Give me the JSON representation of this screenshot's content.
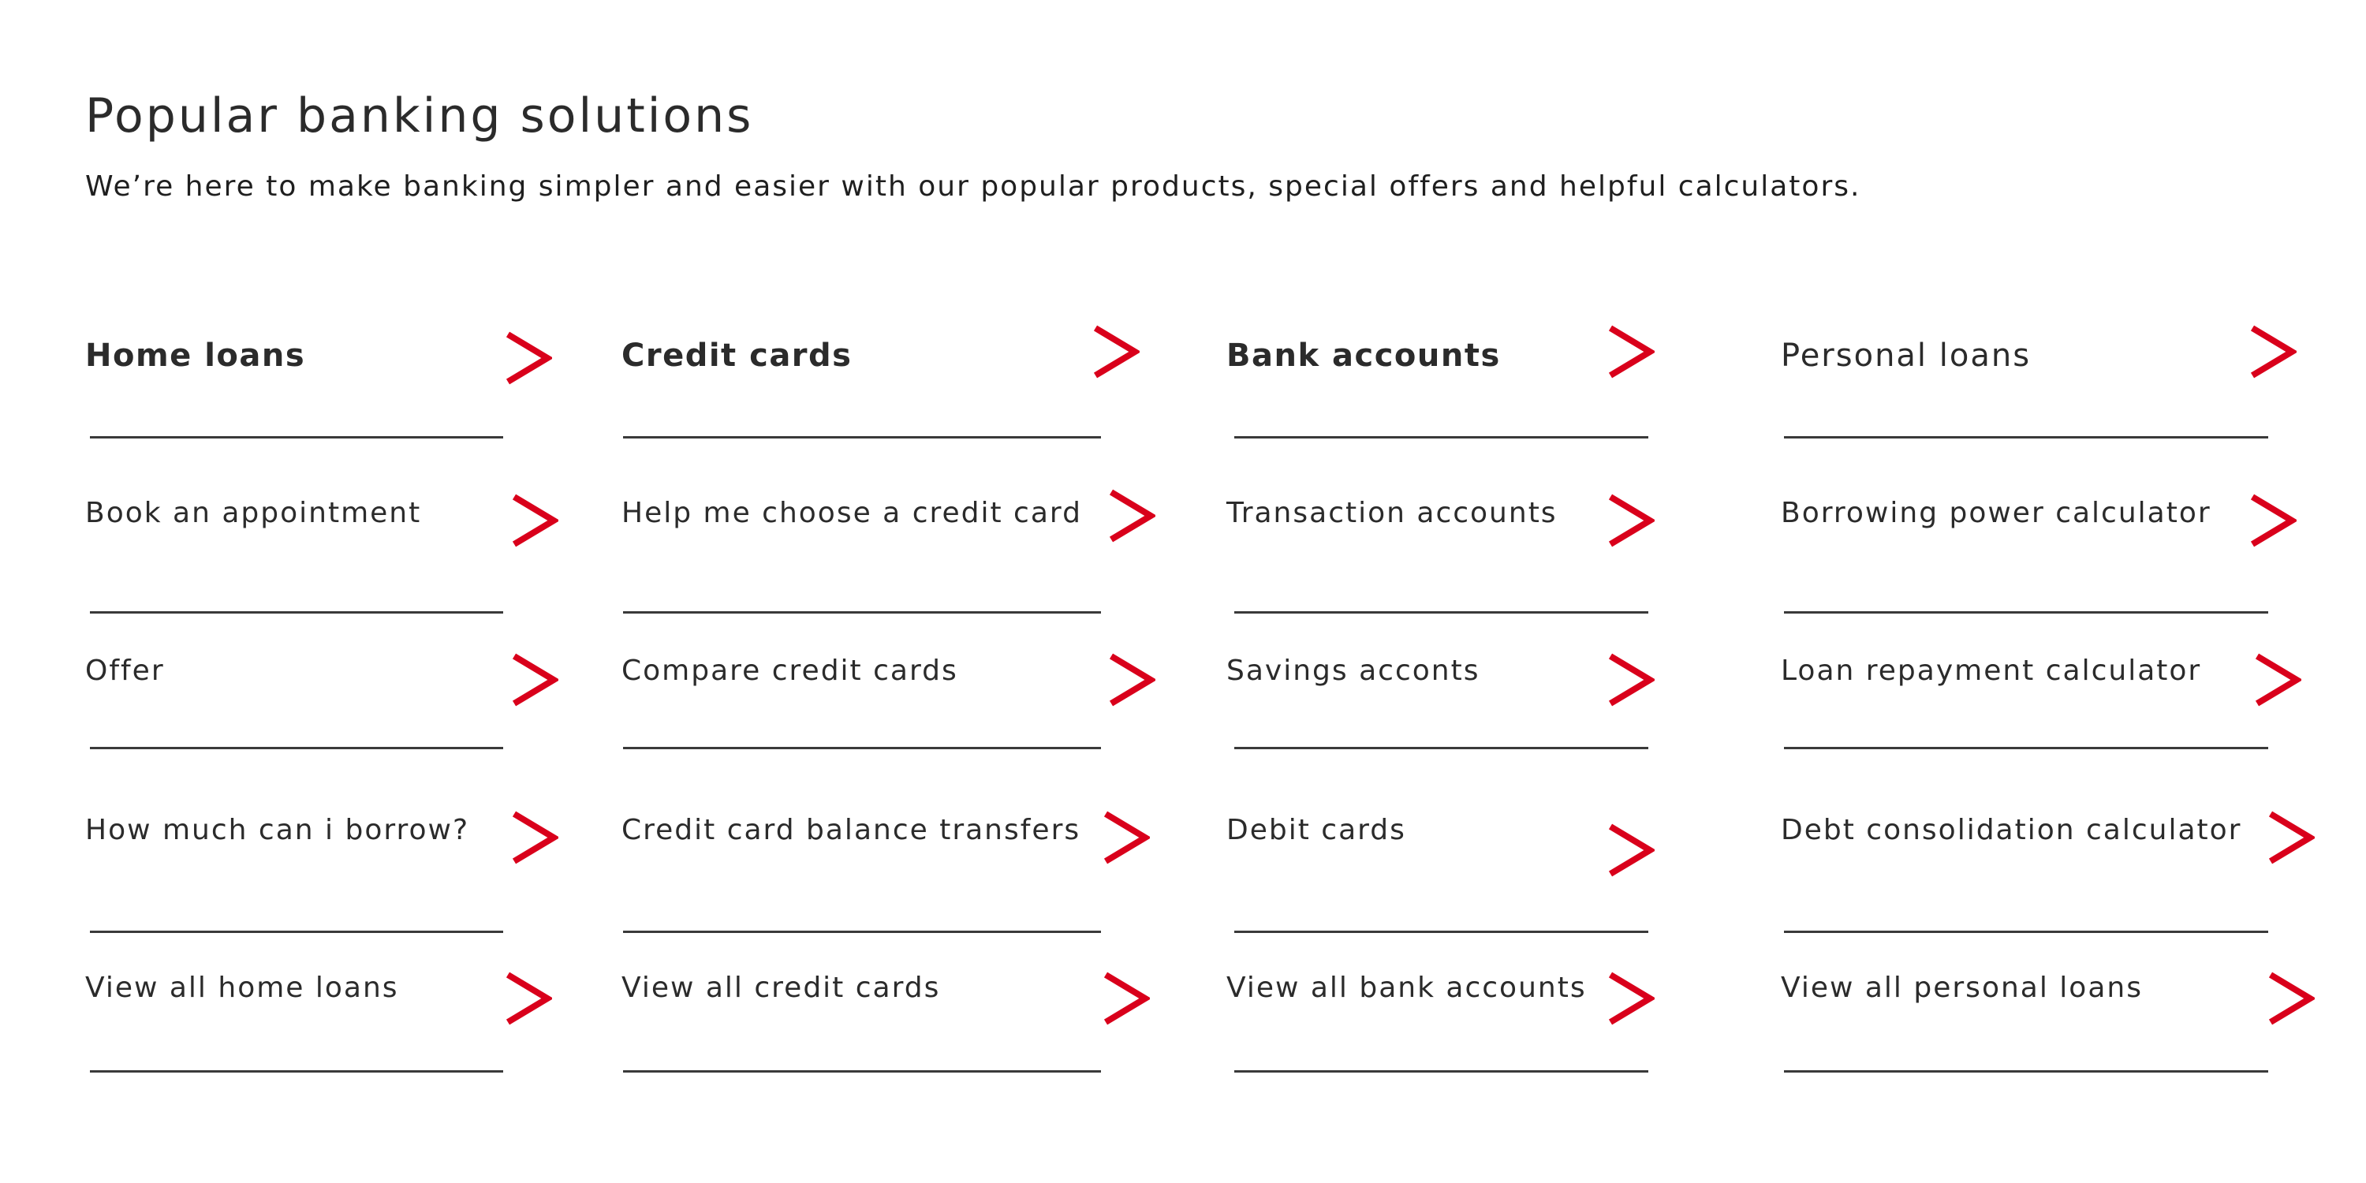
{
  "header": {
    "title": "Popular banking solutions",
    "subtitle": "We’re here to make banking simpler and easier with our popular products, special offers and helpful calculators."
  },
  "theme": {
    "accent": "#d9001b",
    "text": "#2b2b2b",
    "divider": "#3a3a3a"
  },
  "columns": [
    {
      "heading": "Home loans",
      "items": [
        "Book an appointment",
        "Offer",
        "How much can i borrow?",
        "View all home loans"
      ]
    },
    {
      "heading": "Credit cards",
      "items": [
        "Help me choose a credit card",
        "Compare credit cards",
        "Credit card balance transfers",
        "View all credit cards"
      ]
    },
    {
      "heading": "Bank accounts",
      "items": [
        "Transaction accounts",
        "Savings acconts",
        "Debit cards",
        "View all bank accounts"
      ]
    },
    {
      "heading": "Personal loans",
      "items": [
        "Borrowing power calculator",
        "Loan repayment calculator",
        "Debt consolidation calculator",
        "View all personal loans"
      ]
    }
  ],
  "icons": {
    "link_arrow": "chevron-right-icon"
  }
}
